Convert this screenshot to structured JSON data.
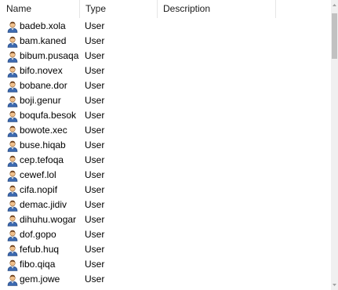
{
  "columns": {
    "name": "Name",
    "type": "Type",
    "description": "Description"
  },
  "rows": [
    {
      "name": "badeb.xola",
      "type": "User",
      "icon": "user-icon"
    },
    {
      "name": "bam.kaned",
      "type": "User",
      "icon": "user-icon"
    },
    {
      "name": "bibum.pusaqa",
      "type": "User",
      "icon": "user-icon"
    },
    {
      "name": "bifo.novex",
      "type": "User",
      "icon": "user-icon"
    },
    {
      "name": "bobane.dor",
      "type": "User",
      "icon": "user-icon"
    },
    {
      "name": "boji.genur",
      "type": "User",
      "icon": "user-icon"
    },
    {
      "name": "boqufa.besok",
      "type": "User",
      "icon": "user-icon"
    },
    {
      "name": "bowote.xec",
      "type": "User",
      "icon": "user-icon"
    },
    {
      "name": "buse.hiqab",
      "type": "User",
      "icon": "user-icon"
    },
    {
      "name": "cep.tefoqa",
      "type": "User",
      "icon": "user-icon"
    },
    {
      "name": "cewef.lol",
      "type": "User",
      "icon": "user-icon"
    },
    {
      "name": "cifa.nopif",
      "type": "User",
      "icon": "user-icon"
    },
    {
      "name": "demac.jidiv",
      "type": "User",
      "icon": "user-icon"
    },
    {
      "name": "dihuhu.wogar",
      "type": "User",
      "icon": "user-icon"
    },
    {
      "name": "dof.gopo",
      "type": "User",
      "icon": "user-icon"
    },
    {
      "name": "fefub.huq",
      "type": "User",
      "icon": "user-icon"
    },
    {
      "name": "fibo.qiqa",
      "type": "User",
      "icon": "user-icon"
    },
    {
      "name": "gem.jowe",
      "type": "User",
      "icon": "user-icon"
    }
  ]
}
